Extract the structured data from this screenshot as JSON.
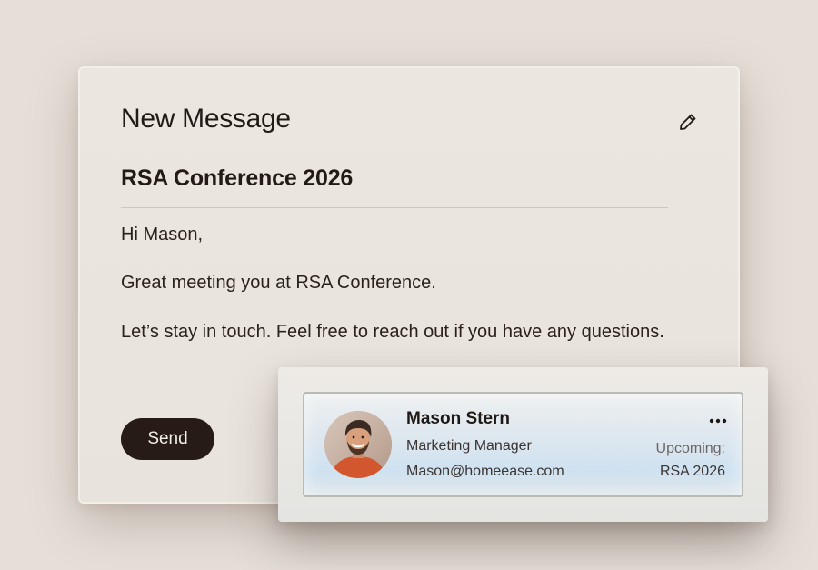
{
  "message": {
    "title": "New Message",
    "subject": "RSA Conference 2026",
    "greeting": "Hi Mason,",
    "body_line1": "Great meeting you at RSA Conference.",
    "body_line2": "Let’s stay in touch. Feel free to reach out if you have any questions.",
    "send_label": "Send",
    "edit_icon": "pencil-icon"
  },
  "contact": {
    "name": "Mason Stern",
    "role": "Marketing Manager",
    "email": "Mason@homeease.com",
    "upcoming_label": "Upcoming:",
    "upcoming_event": "RSA 2026",
    "more_icon": "more-horizontal-icon"
  },
  "colors": {
    "background": "#e6dfd8",
    "card": "#ebe5df",
    "send_button": "#261b17",
    "contact_gradient_accent": "#cfe2f1"
  }
}
